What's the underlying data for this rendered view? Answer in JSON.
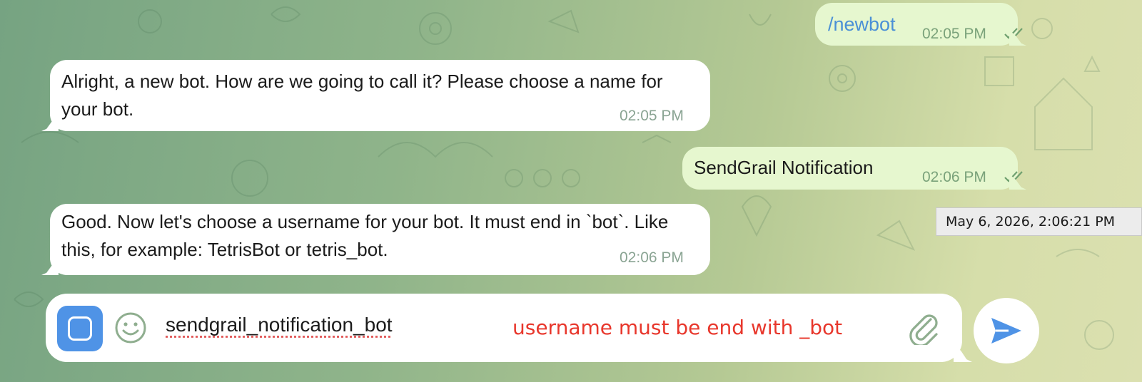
{
  "messages": [
    {
      "direction": "outgoing",
      "text": "/newbot",
      "time": "02:05 PM",
      "status": "read"
    },
    {
      "direction": "incoming",
      "text": "Alright, a new bot. How are we going to call it? Please choose a name for your bot.",
      "time": "02:05 PM"
    },
    {
      "direction": "outgoing",
      "text": "SendGrail Notification",
      "time": "02:06 PM",
      "status": "read"
    },
    {
      "direction": "incoming",
      "text": "Good. Now let's choose a username for your bot. It must end in `bot`. Like this, for example: TetrisBot or tetris_bot.",
      "time": "02:06 PM"
    }
  ],
  "tooltip": {
    "text": "May 6, 2026, 2:06:21 PM"
  },
  "composer": {
    "input_value": "sendgrail_notification_bot",
    "annotation": "username must be end with _bot",
    "menu_icon": "menu-square-icon",
    "emoji_icon": "smiley-icon",
    "attach_icon": "paperclip-icon",
    "send_icon": "send-arrow-icon"
  },
  "colors": {
    "outgoing_bubble": "#e6f7cf",
    "incoming_bubble": "#ffffff",
    "accent": "#4f93e6",
    "annotation": "#e8372c",
    "timestamp": "#7aa27a"
  }
}
